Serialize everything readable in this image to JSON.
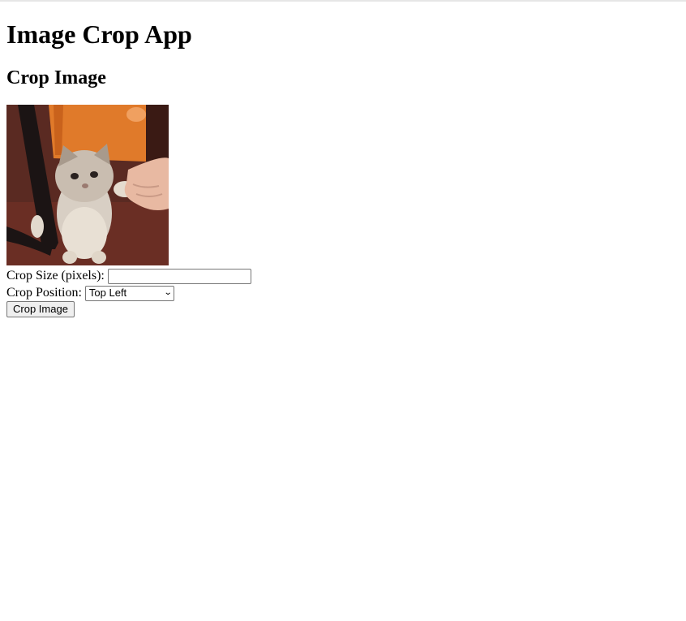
{
  "app": {
    "title": "Image Crop App",
    "subtitle": "Crop Image"
  },
  "image": {
    "icon": "cat-photo"
  },
  "form": {
    "size_label": "Crop Size (pixels):",
    "size_value": "",
    "position_label": "Crop Position:",
    "position_selected": "Top Left",
    "submit_label": "Crop Image"
  }
}
